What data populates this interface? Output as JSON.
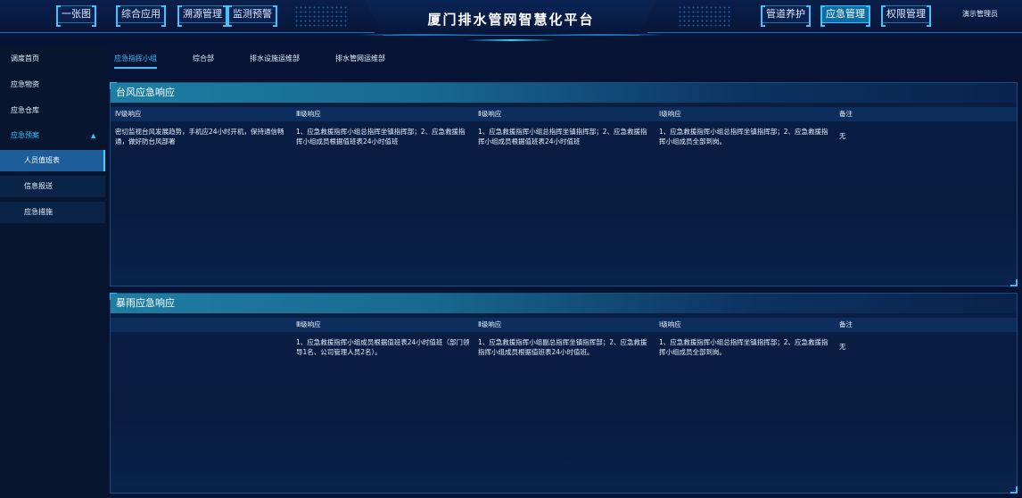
{
  "header": {
    "title": "厦门排水管网智慧化平台",
    "nav_left": [
      "一张图",
      "综合应用",
      "溯源管理",
      "监测预警"
    ],
    "nav_right": [
      "管道养护",
      "应急管理",
      "权限管理"
    ],
    "active_nav": "应急管理",
    "user": "演示管理员"
  },
  "sidebar": {
    "items": [
      {
        "label": "调度首页"
      },
      {
        "label": "应急物资"
      },
      {
        "label": "应急仓库"
      },
      {
        "label": "应急预案",
        "expanded": true
      },
      {
        "label": "人员值班表",
        "active": true
      },
      {
        "label": "信息报送"
      },
      {
        "label": "应急措施"
      }
    ],
    "chevron_icon": "chevron-up-icon"
  },
  "tabs": [
    "应急指挥小组",
    "综合部",
    "排水设施运维部",
    "排水管网运维部"
  ],
  "active_tab": "应急指挥小组",
  "typhoon": {
    "title": "台风应急响应",
    "headers": [
      "Ⅳ级响应",
      "Ⅲ级响应",
      "Ⅱ级响应",
      "Ⅰ级响应",
      "备注"
    ],
    "row": [
      "密切监视台风发展趋势，手机应24小时开机，保持通信畅通，做好防台风部署",
      "1、应急救援指挥小组总指挥坐镇指挥部；2、应急救援指挥小组成员根据值班表24小时值班",
      "1、应急救援指挥小组总指挥坐镇指挥部；2、应急救援指挥小组成员根据值班表24小时值班",
      "1、应急救援指挥小组总指挥坐镇指挥部；2、应急救援指挥小组成员全部到岗。",
      "无"
    ]
  },
  "rainstorm": {
    "title": "暴雨应急响应",
    "headers": [
      "Ⅲ级响应",
      "Ⅱ级响应",
      "Ⅰ级响应",
      "备注"
    ],
    "row": [
      "1、应急救援指挥小组成员根据值班表24小时值班（部门领导1名、公司管理人员2名）。",
      "1、应急救援指挥小组副总指挥坐镇指挥部；2、应急救援指挥小组成员根据值班表24小时值班。",
      "1、应急救援指挥小组总指挥坐镇指挥部；2、应急救援指挥小组成员全部到岗。",
      "无"
    ]
  },
  "colors": {
    "background": "#061334",
    "accent": "#2fc6ff",
    "panel_title": "#1e7ea3",
    "active_nav": "#0e6da2"
  }
}
